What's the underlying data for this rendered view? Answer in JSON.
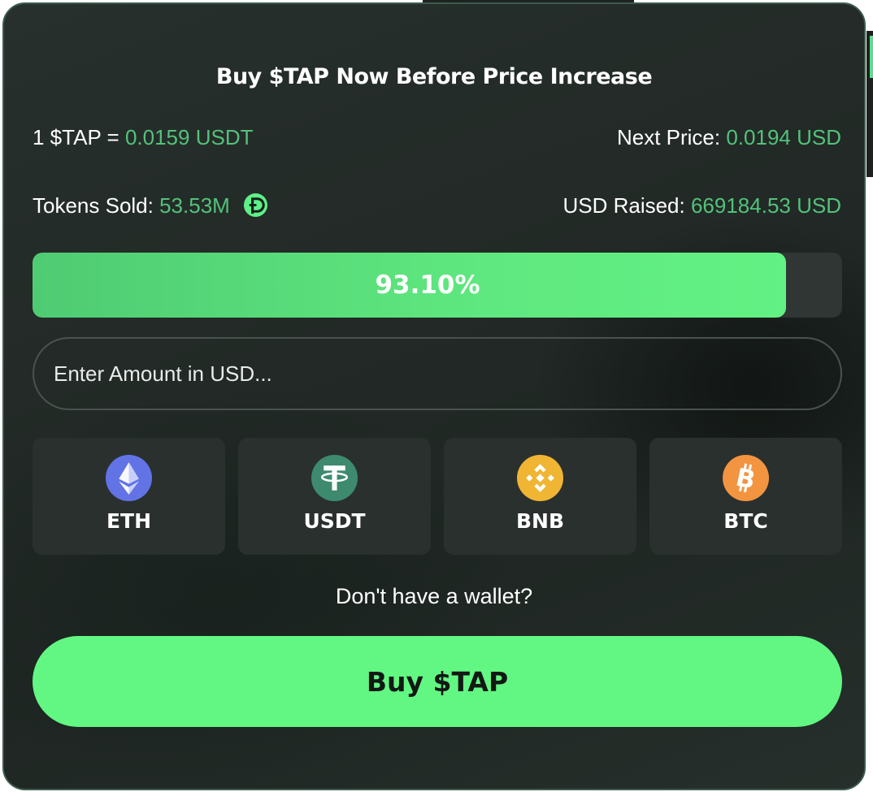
{
  "widget": {
    "title": "Buy $TAP Now Before Price Increase",
    "price_label": "1 $TAP = ",
    "price_value": "0.0159 USDT",
    "next_price_label": "Next Price: ",
    "next_price_value": "0.0194 USD",
    "tokens_sold_label": "Tokens Sold: ",
    "tokens_sold_value": "53.53M",
    "usd_raised_label": "USD Raised: ",
    "usd_raised_value": "669184.53 USD",
    "progress": {
      "label": "93.10%",
      "percent": 93.1
    },
    "amount_input": {
      "placeholder": "Enter Amount in USD...",
      "value": ""
    },
    "tokens": [
      {
        "label": "ETH",
        "icon": "ethereum-icon",
        "color": "#6273e6"
      },
      {
        "label": "USDT",
        "icon": "tether-icon",
        "color": "#3d8a6f"
      },
      {
        "label": "BNB",
        "icon": "binance-icon",
        "color": "#efb533"
      },
      {
        "label": "BTC",
        "icon": "bitcoin-icon",
        "color": "#f29440"
      }
    ],
    "wallet_link": "Don't have a wallet?",
    "buy_button": "Buy $TAP"
  },
  "colors": {
    "accent_green": "#62f783",
    "value_green": "#53c27a",
    "card_bg": "#232a27",
    "card_border": "#3f5b4e"
  }
}
